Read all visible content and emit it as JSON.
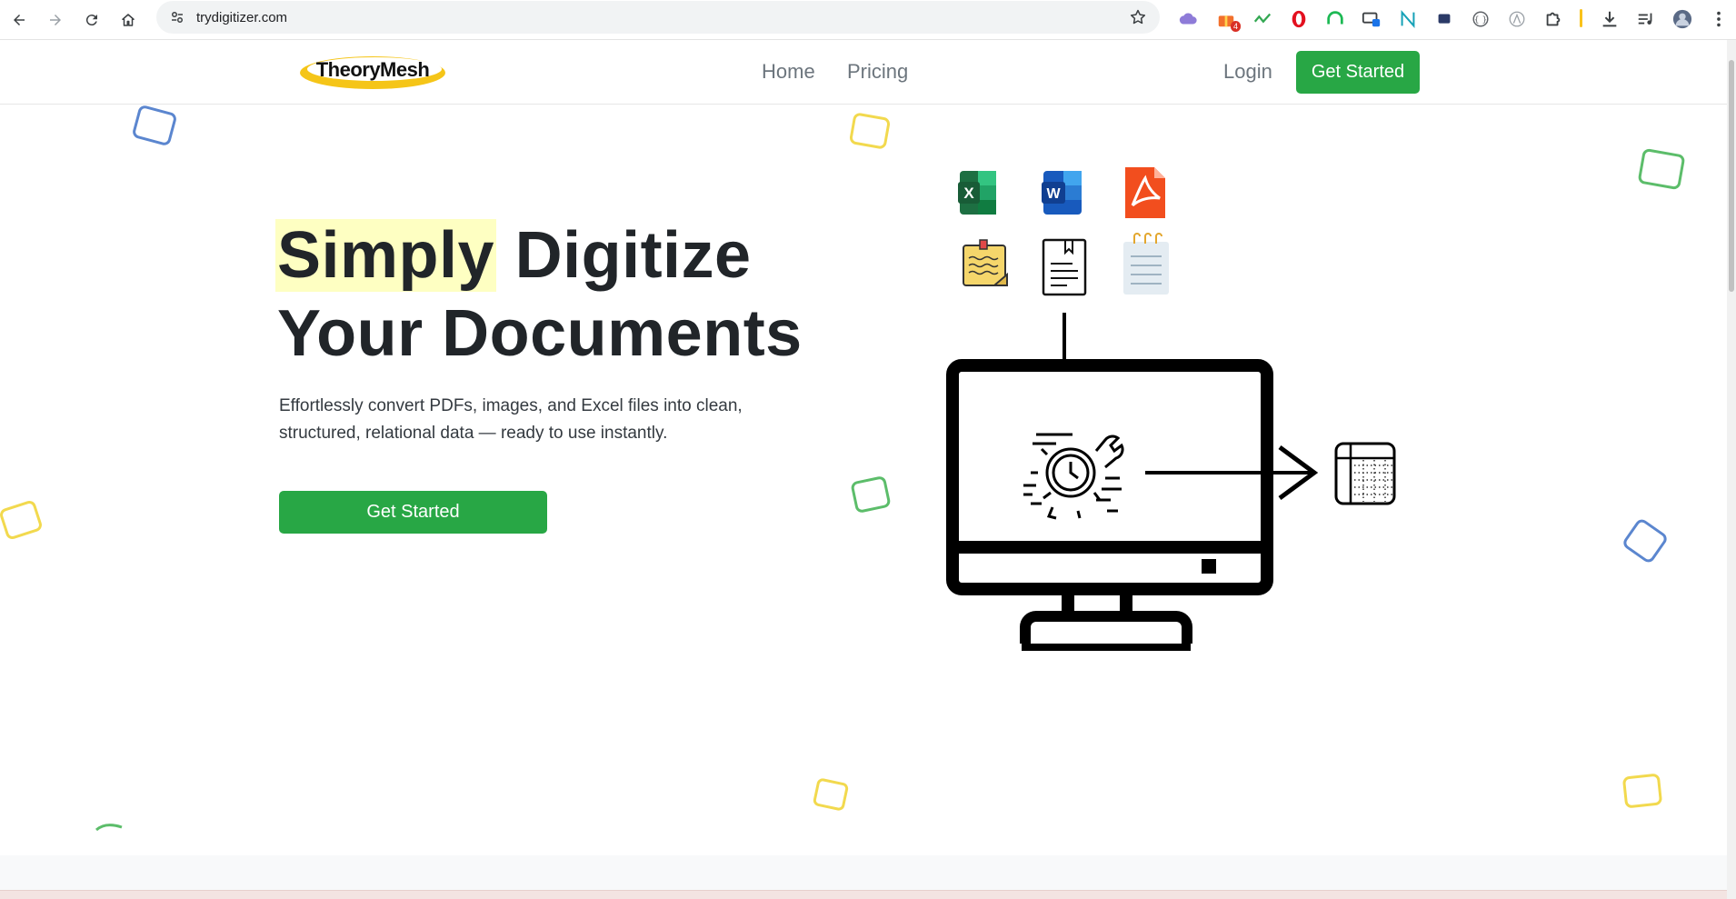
{
  "browser": {
    "url": "trydigitizer.com",
    "extensions": [
      {
        "icon": "cloud-extension-icon",
        "color": "#8e7bd8"
      },
      {
        "icon": "gift-extension-icon",
        "color": "#f2702c",
        "badge": "4"
      },
      {
        "icon": "trend-extension-icon",
        "color": "#34a853"
      },
      {
        "icon": "opera-extension-icon",
        "color": "#e3101f"
      },
      {
        "icon": "headphones-extension-icon",
        "color": "#1db954"
      },
      {
        "icon": "screen-extension-icon",
        "color": "#3c4043"
      },
      {
        "icon": "n-extension-icon",
        "color": "#17a2b8"
      },
      {
        "icon": "chat-extension-icon",
        "color": "#2b3a67"
      },
      {
        "icon": "bracket-extension-icon",
        "color": "#5f6368"
      },
      {
        "icon": "script-extension-icon",
        "color": "#9aa0a6"
      },
      {
        "icon": "puzzle-icon",
        "color": "#3c4043"
      }
    ]
  },
  "header": {
    "logo_text": "TheoryMesh",
    "nav": [
      "Home",
      "Pricing"
    ],
    "login": "Login",
    "cta": "Get Started"
  },
  "hero": {
    "title_highlight": "Simply",
    "title_rest": " Digitize",
    "title_line2": "Your Documents",
    "subtitle": "Effortlessly convert PDFs, images, and Excel files into clean, structured, relational data — ready to use instantly.",
    "cta": "Get Started"
  },
  "illustration": {
    "file_icons": [
      "excel-icon",
      "word-icon",
      "pdf-icon",
      "sticky-note-icon",
      "document-icon",
      "notepad-icon"
    ],
    "excel_letter": "X",
    "word_letter": "W"
  },
  "colors": {
    "accent_green": "#28a745",
    "highlight": "#feffc2",
    "deco_blue": "#5b86cf",
    "deco_yellow": "#f2d94e",
    "deco_green": "#5cbd6a"
  }
}
